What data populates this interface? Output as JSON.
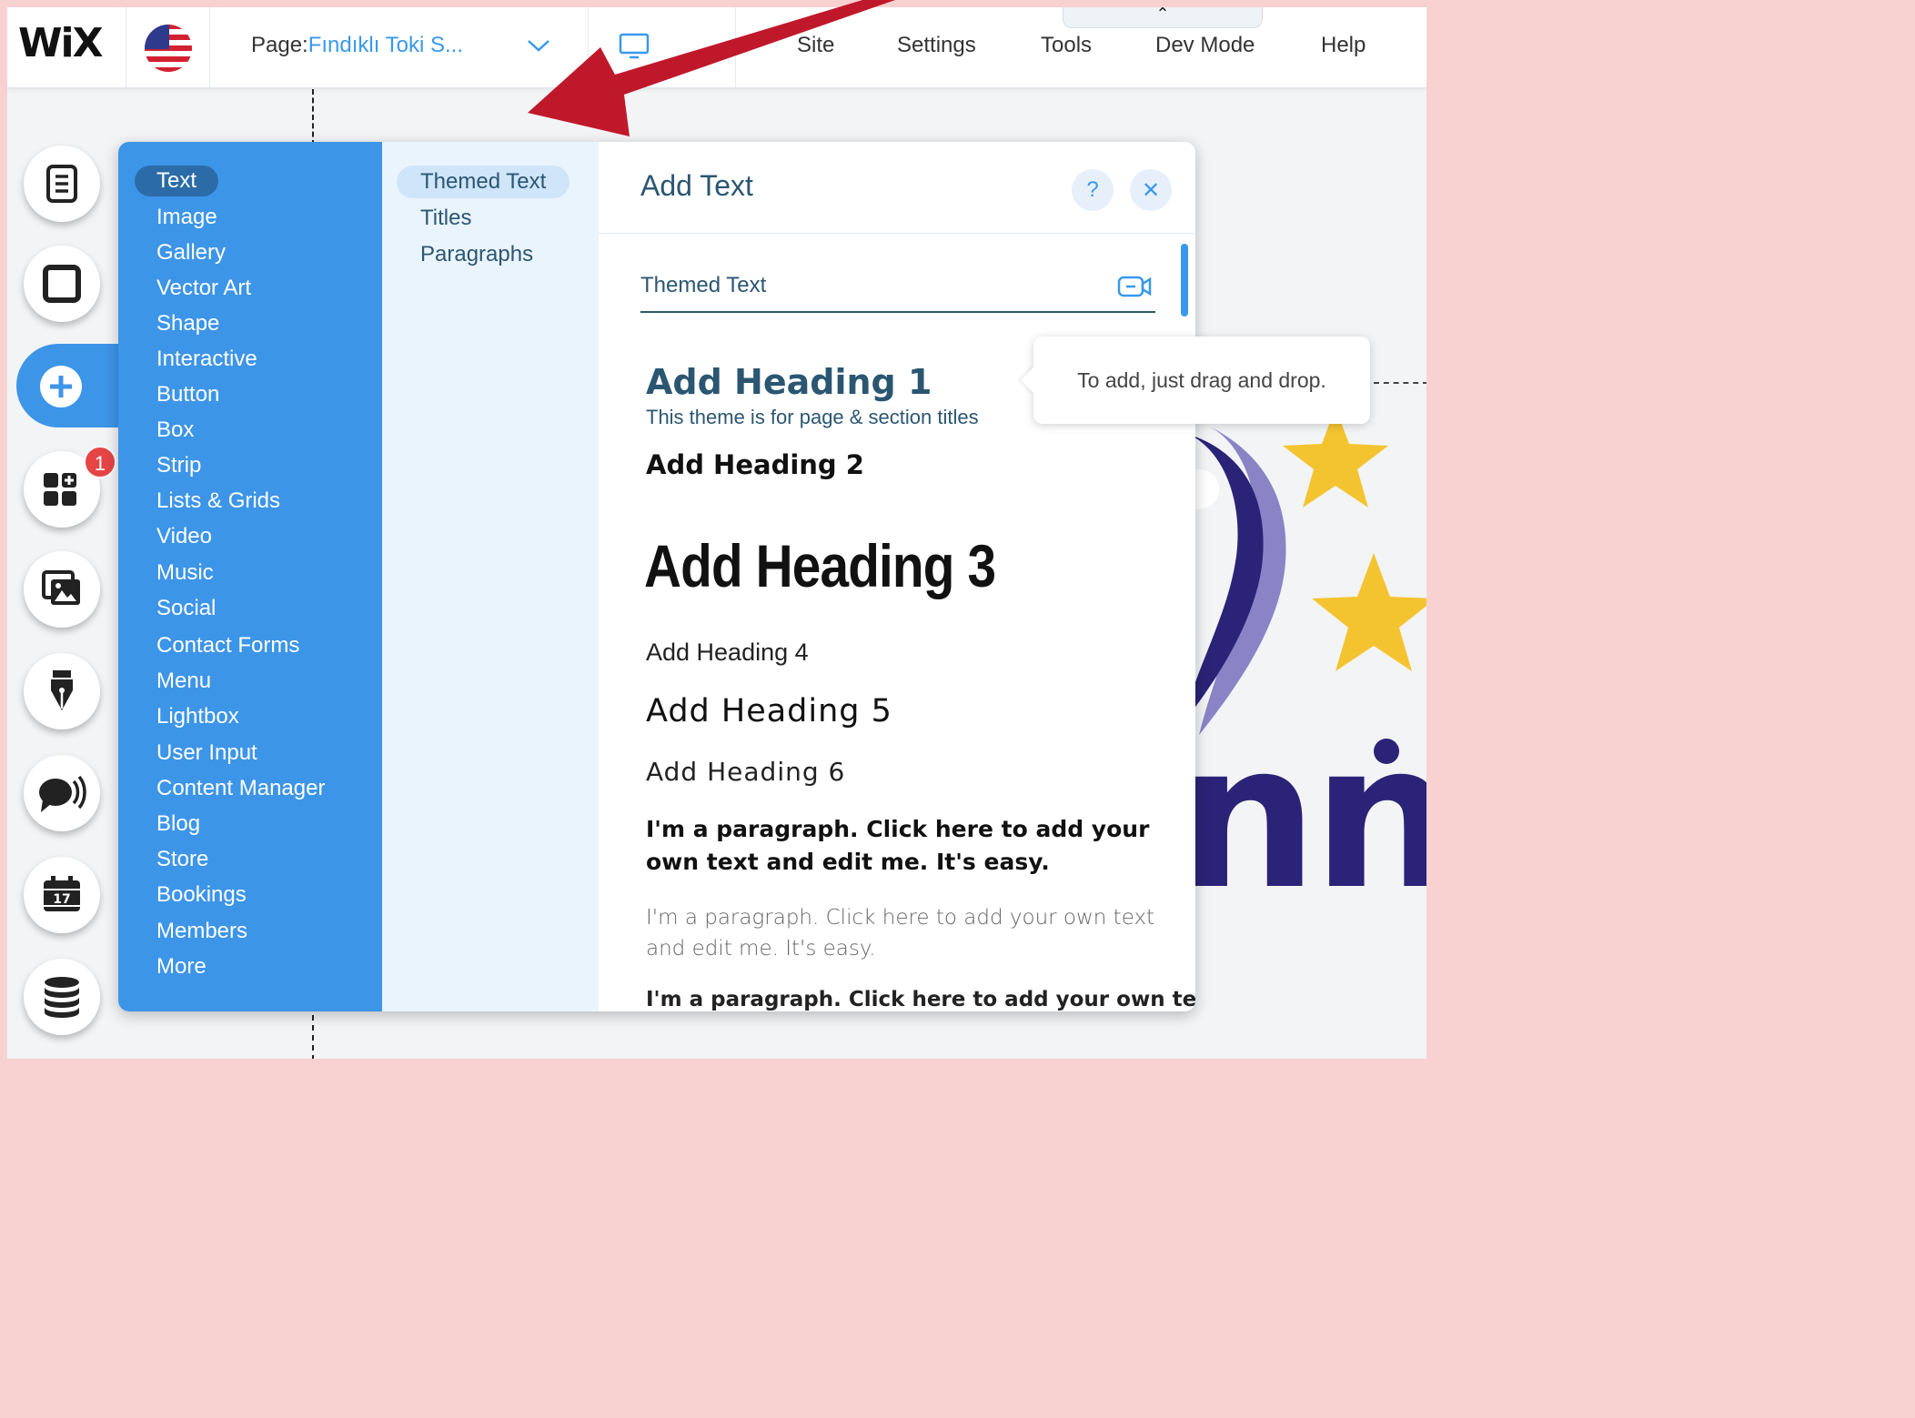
{
  "topbar": {
    "logo": "WiX",
    "page_label": "Page:",
    "page_name": "Fındıklı Toki S...",
    "menu": [
      "Site",
      "Settings",
      "Tools",
      "Dev Mode",
      "Help"
    ],
    "devmode_caret": "⌃"
  },
  "rail": {
    "items": [
      "pages-icon",
      "background-icon",
      "add-icon",
      "app-market-icon",
      "media-icon",
      "blog-icon",
      "chat-icon",
      "bookings-icon",
      "database-icon"
    ],
    "badge": "1"
  },
  "add_panel": {
    "categories": [
      "Text",
      "Image",
      "Gallery",
      "Vector Art",
      "Shape",
      "Interactive",
      "Button",
      "Box",
      "Strip",
      "Lists & Grids",
      "Video",
      "Music",
      "Social",
      "Contact Forms",
      "Menu",
      "Lightbox",
      "User Input",
      "Content Manager",
      "Blog",
      "Store",
      "Bookings",
      "Members",
      "More"
    ],
    "active_category": "Text",
    "subcategories": [
      "Themed Text",
      "Titles",
      "Paragraphs"
    ],
    "title": "Add Text",
    "help_label": "?",
    "close_label": "✕",
    "section_label": "Themed Text",
    "heading1": "Add Heading 1",
    "heading1_sub": "This theme is for page & section titles",
    "heading2": "Add Heading 2",
    "heading3": "Add Heading 3",
    "heading4": "Add Heading 4",
    "heading5": "Add Heading 5",
    "heading6": "Add Heading 6",
    "paragraph1": "I'm a paragraph. Click here to add your own text and edit me. It's easy.",
    "paragraph2": "I'm a paragraph. Click here to add your own text and edit me. It's easy.",
    "paragraph3": "I'm a paragraph. Click here to add your own text"
  },
  "tooltip": "To add, just drag and drop.",
  "canvas": {
    "logo_text": "nni"
  },
  "colors": {
    "wix_blue": "#3d95e8",
    "accent_blue": "#3899ec",
    "text_navy": "#2b5672",
    "arrow_red": "#c0182b",
    "badge_red": "#e64545",
    "site_navy": "#2b2377",
    "site_star": "#f4c430"
  }
}
